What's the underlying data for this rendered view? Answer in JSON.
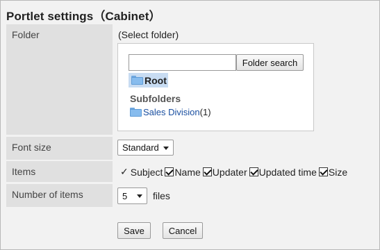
{
  "page": {
    "title": "Portlet settings（Cabinet）"
  },
  "folder": {
    "label": "Folder",
    "select_text": "(Select folder)",
    "search_value": "",
    "search_button": "Folder search",
    "root_label": "Root",
    "subfolders_heading": "Subfolders",
    "subfolders": [
      {
        "name": "Sales Division",
        "count": "(1)"
      }
    ]
  },
  "font_size": {
    "label": "Font size",
    "selected": "Standard"
  },
  "items": {
    "label": "Items",
    "options": [
      {
        "label": "Subject",
        "checked": true,
        "fixed": true
      },
      {
        "label": "Name",
        "checked": true
      },
      {
        "label": "Updater",
        "checked": true
      },
      {
        "label": "Updated time",
        "checked": true
      },
      {
        "label": "Size",
        "checked": true
      }
    ]
  },
  "number_of_items": {
    "label": "Number of items",
    "selected": "5",
    "unit": "files"
  },
  "actions": {
    "save": "Save",
    "cancel": "Cancel"
  }
}
